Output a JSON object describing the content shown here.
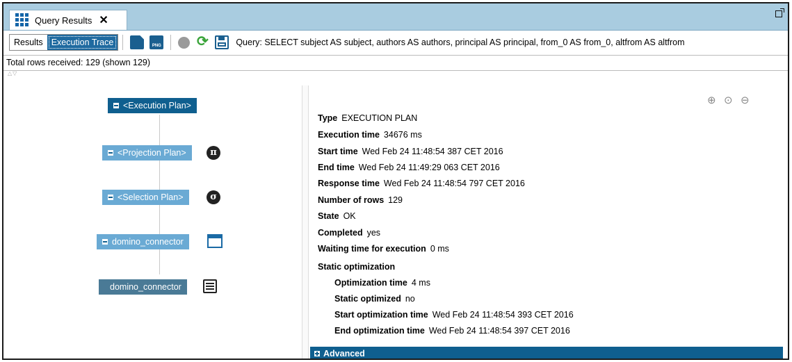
{
  "tab": {
    "title": "Query Results",
    "close": "✕"
  },
  "toolbar": {
    "results_label": "Results",
    "trace_label": "Execution Trace",
    "png_label": "PNG",
    "refresh_glyph": "⟳",
    "query_text": "Query: SELECT subject AS subject, authors AS authors, principal AS principal, from_0 AS from_0, altfrom AS altfrom"
  },
  "status": {
    "rows_text": "Total rows received: 129 (shown 129)",
    "arrows": "△▽"
  },
  "tree": {
    "nodes": [
      {
        "label": "<Execution Plan>"
      },
      {
        "label": "<Projection Plan>",
        "icon_glyph": "π"
      },
      {
        "label": "<Selection Plan>",
        "icon_glyph": "σ"
      },
      {
        "label": "domino_connector"
      },
      {
        "label": "domino_connector"
      }
    ]
  },
  "details": {
    "zoom": {
      "in": "⊕",
      "reset": "⊙",
      "out": "⊖"
    },
    "properties": [
      {
        "key": "Type",
        "value": "EXECUTION PLAN"
      },
      {
        "key": "Execution time",
        "value": "34676 ms"
      },
      {
        "key": "Start time",
        "value": "Wed Feb 24 11:48:54 387 CET 2016"
      },
      {
        "key": "End time",
        "value": "Wed Feb 24 11:49:29 063 CET 2016"
      },
      {
        "key": "Response time",
        "value": "Wed Feb 24 11:48:54 797 CET 2016"
      },
      {
        "key": "Number of rows",
        "value": "129"
      },
      {
        "key": "State",
        "value": "OK"
      },
      {
        "key": "Completed",
        "value": "yes"
      },
      {
        "key": "Waiting time for execution",
        "value": "0 ms"
      }
    ],
    "static_optimization": {
      "heading": "Static optimization",
      "items": [
        {
          "key": "Optimization time",
          "value": "4 ms"
        },
        {
          "key": "Static optimized",
          "value": "no"
        },
        {
          "key": "Start optimization time",
          "value": "Wed Feb 24 11:48:54 393 CET 2016"
        },
        {
          "key": "End optimization time",
          "value": "Wed Feb 24 11:48:54 397 CET 2016"
        }
      ]
    },
    "advanced_label": "Advanced"
  }
}
